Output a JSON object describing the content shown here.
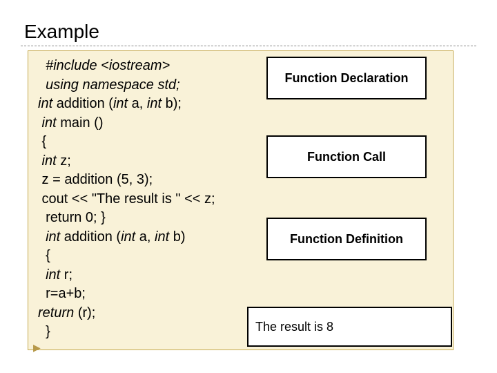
{
  "title": "Example",
  "code": {
    "l1": "  #include <iostream>",
    "l2": "  using namespace std;",
    "l3_a": "int ",
    "l3_b": "addition (",
    "l3_c": "int ",
    "l3_d": "a, ",
    "l3_e": "int ",
    "l3_f": "b);",
    "l4_a": " int ",
    "l4_b": "main ()",
    "l5": " {",
    "l6_a": " int ",
    "l6_b": "z;",
    "l7": " z = addition (5, 3);",
    "l8": " cout << \"The result is \" << z;",
    "l9": "  return 0; }",
    "l10_a": "  int ",
    "l10_b": "addition (",
    "l10_c": "int ",
    "l10_d": "a, ",
    "l10_e": "int ",
    "l10_f": "b)",
    "l11": "  {",
    "l12_a": "  int ",
    "l12_b": "r;",
    "l13": "  r=a+b;",
    "l14_a": "return ",
    "l14_b": "(r);",
    "l15": "  }"
  },
  "labels": {
    "declaration": "Function Declaration",
    "call": "Function Call",
    "definition": "Function Definition",
    "result": "The result is 8"
  }
}
